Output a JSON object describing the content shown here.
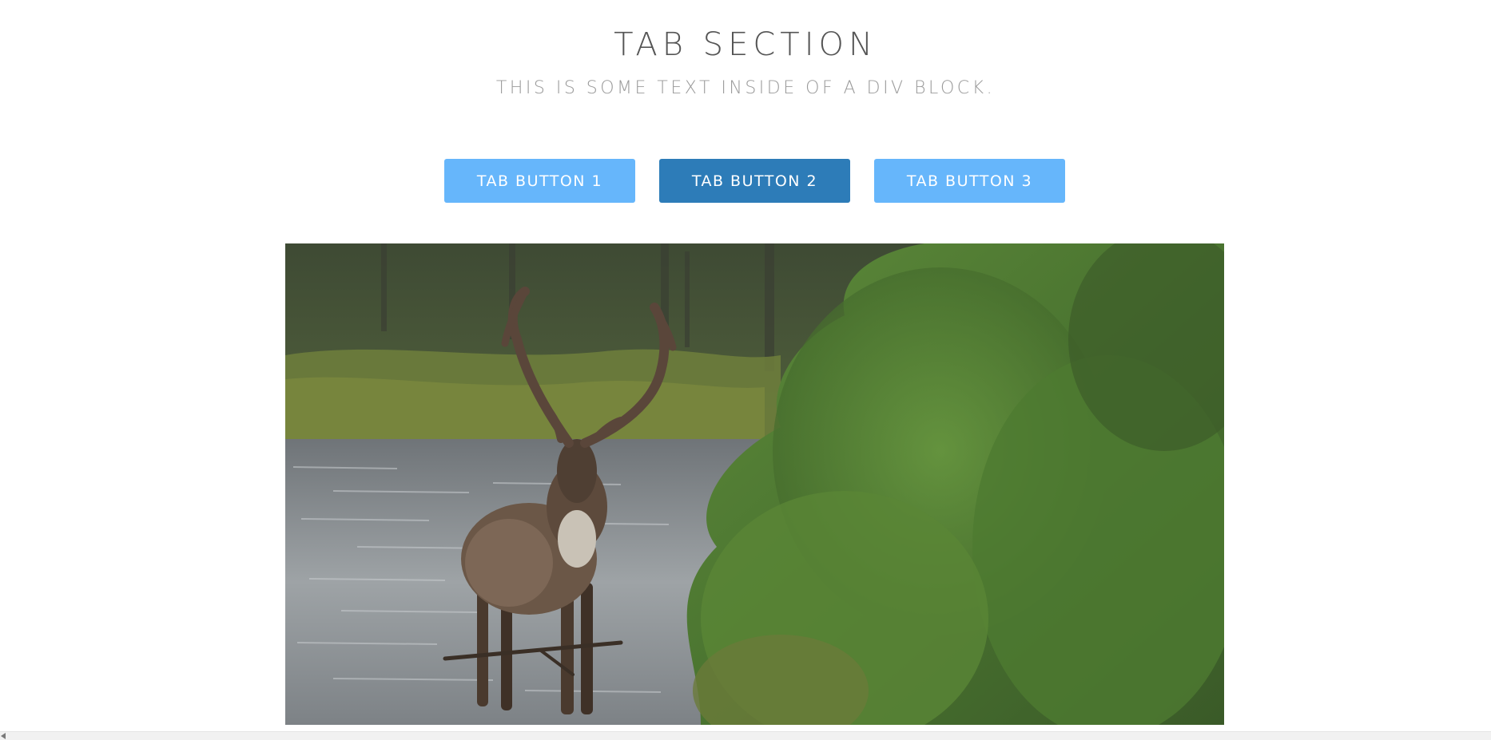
{
  "header": {
    "title": "TAB SECTION",
    "subtitle": "THIS IS SOME TEXT INSIDE OF A DIV BLOCK."
  },
  "tabs": [
    {
      "label": "TAB BUTTON 1",
      "active": false
    },
    {
      "label": "TAB BUTTON 2",
      "active": true
    },
    {
      "label": "TAB BUTTON 3",
      "active": false
    }
  ],
  "colors": {
    "tab_inactive": "#66b6fb",
    "tab_active": "#2d7cb8",
    "heading": "#555555",
    "subheading": "#9a9a9a"
  },
  "tab_content": {
    "image_subject": "caribou standing in a forest stream"
  }
}
